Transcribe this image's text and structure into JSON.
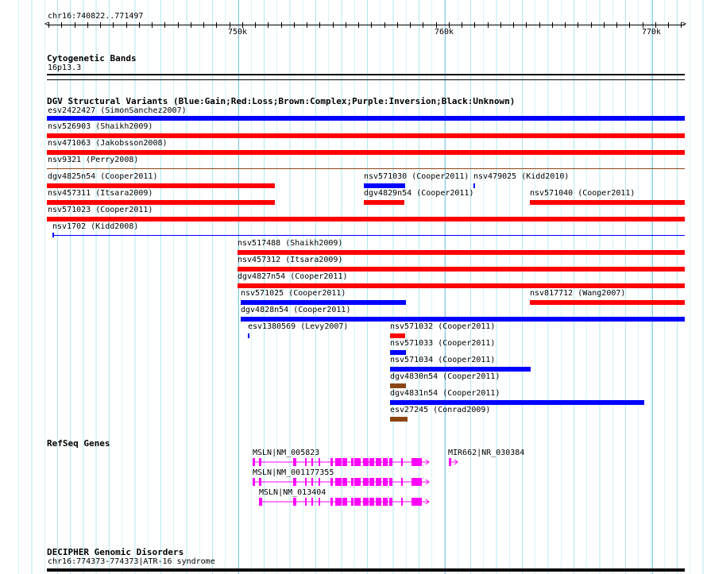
{
  "ruler": {
    "position": "chr16:740822..771497",
    "ticks": [
      "750k",
      "760k",
      "770k"
    ]
  },
  "cyto": {
    "title": "Cytogenetic Bands",
    "band": "16p13.3"
  },
  "dgv": {
    "title": "DGV Structural Variants (Blue:Gain;Red:Loss;Brown:Complex;Purple:Inversion;Black:Unknown)",
    "colors": {
      "gain": "#0000ff",
      "loss": "#ff0000",
      "complex": "#8b4513"
    },
    "variants": [
      {
        "label": "esv2422427 (SimonSanchez2007)",
        "type": "gain"
      },
      {
        "label": "nsv526903 (Shaikh2009)",
        "type": "loss"
      },
      {
        "label": "nsv471063 (Jakobsson2008)",
        "type": "loss"
      },
      {
        "label": "nsv9321 (Perry2008)",
        "type": "complex"
      },
      {
        "label": "dgv4825n54 (Cooper2011)",
        "type": "loss"
      },
      {
        "label": "nsv571030 (Cooper2011)",
        "type": "gain"
      },
      {
        "label": "nsv479025 (Kidd2010)",
        "type": "gain"
      },
      {
        "label": "nsv457311 (Itsara2009)",
        "type": "loss"
      },
      {
        "label": "dgv4829n54 (Cooper2011)",
        "type": "loss"
      },
      {
        "label": "nsv571040 (Cooper2011)",
        "type": "loss"
      },
      {
        "label": "nsv571023 (Cooper2011)",
        "type": "loss"
      },
      {
        "label": "nsv1702 (Kidd2008)",
        "type": "gain"
      },
      {
        "label": "nsv517488 (Shaikh2009)",
        "type": "loss"
      },
      {
        "label": "nsv457312 (Itsara2009)",
        "type": "loss"
      },
      {
        "label": "dgv4827n54 (Cooper2011)",
        "type": "loss"
      },
      {
        "label": "nsv571025 (Cooper2011)",
        "type": "gain"
      },
      {
        "label": "nsv817712 (Wang2007)",
        "type": "loss"
      },
      {
        "label": "dgv4828n54 (Cooper2011)",
        "type": "gain"
      },
      {
        "label": "esv1380569 (Levy2007)",
        "type": "gain"
      },
      {
        "label": "nsv571032 (Cooper2011)",
        "type": "loss"
      },
      {
        "label": "nsv571033 (Cooper2011)",
        "type": "gain"
      },
      {
        "label": "nsv571034 (Cooper2011)",
        "type": "gain"
      },
      {
        "label": "dgv4830n54 (Cooper2011)",
        "type": "complex"
      },
      {
        "label": "dgv4831n54 (Cooper2011)",
        "type": "gain"
      },
      {
        "label": "esv27245 (Conrad2009)",
        "type": "complex"
      }
    ]
  },
  "refseq": {
    "title": "RefSeq Genes",
    "color": "#ff00ff",
    "genes": [
      "MSLN|NM_005823",
      "MSLN|NM_001177355",
      "MSLN|NM_013404",
      "MIR662|NR_030384"
    ]
  },
  "decipher": {
    "title": "DECIPHER Genomic Disorders",
    "entry": "chr16:774373-774373|ATR-16 syndrome"
  }
}
